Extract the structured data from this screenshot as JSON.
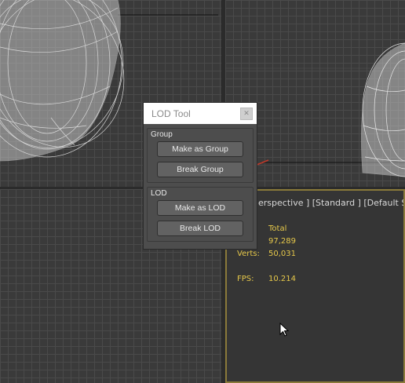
{
  "lod_tool": {
    "title": "LOD Tool",
    "close_icon": "close-icon",
    "group_section": {
      "label": "Group",
      "make_label": "Make as Group",
      "break_label": "Break Group"
    },
    "lod_section": {
      "label": "LOD",
      "make_label": "Make as LOD",
      "break_label": "Break LOD"
    }
  },
  "viewport": {
    "label": "erspective ] [Standard ] [Default Shadin",
    "stats": {
      "header": "Total",
      "polys_value": "97,289",
      "verts_label": "Verts:",
      "verts_value": "50,031",
      "fps_label": "FPS:",
      "fps_value": "10.214"
    }
  },
  "colors": {
    "stats": "#e6c84a",
    "active_border": "#8a7a3a",
    "grid": "#4a4a4a"
  }
}
